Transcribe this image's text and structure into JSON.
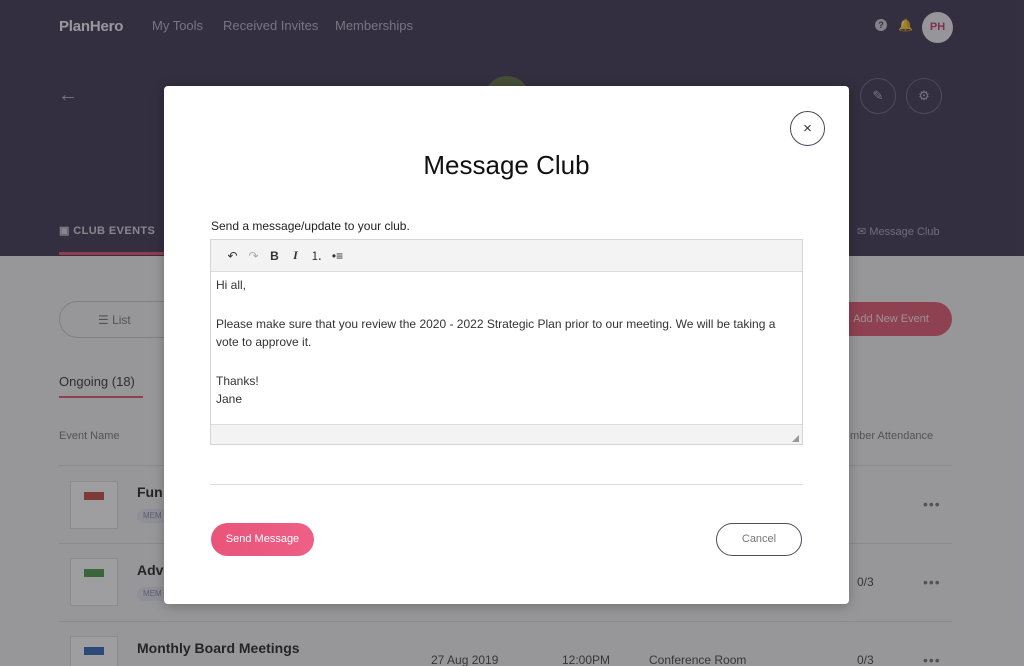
{
  "app": {
    "brand": "PlanHero",
    "nav": [
      "My Tools",
      "Received Invites",
      "Memberships"
    ],
    "avatar_initials": "PH",
    "help_icon": "?",
    "bell_icon": "🔔"
  },
  "club_page": {
    "tab_events": "CLUB EVENTS",
    "tab_message": "Message Club",
    "view_toggle_label": "List",
    "add_event_label": "Add New Event",
    "ongoing_label": "Ongoing (18)",
    "columns": {
      "event_name": "Event Name",
      "attendance": "mber Attendance"
    },
    "rows": [
      {
        "name": "Fun",
        "tag": "MEM",
        "thumb_color": "#c4493c",
        "more": "•••"
      },
      {
        "name": "Adv",
        "tag": "MEM",
        "thumb_color": "#4c9a4a",
        "attendance": "0/3",
        "more": "•••"
      },
      {
        "name": "Monthly Board Meetings",
        "date": "27 Aug 2019",
        "time": "12:00PM",
        "location": "Conference Room",
        "attendance": "0/3",
        "thumb_color": "#3066b5",
        "more": "•••"
      }
    ]
  },
  "modal": {
    "title": "Message Club",
    "close_label": "×",
    "label": "Send a message/update to your club.",
    "toolbar": {
      "undo": "↶",
      "redo": "↷",
      "bold": "B",
      "italic": "I",
      "ordered_list": "⒈",
      "bullet_list": "•≡"
    },
    "message": {
      "greeting": "Hi all,",
      "body": "Please make sure that you review the 2020 - 2022  Strategic Plan prior to our meeting. We will be taking a vote to approve it.",
      "closing": "Thanks!",
      "signature": "Jane"
    },
    "send_label": "Send Message",
    "cancel_label": "Cancel"
  },
  "colors": {
    "header_purple": "#3f3651",
    "accent_pink": "#e9547a"
  }
}
